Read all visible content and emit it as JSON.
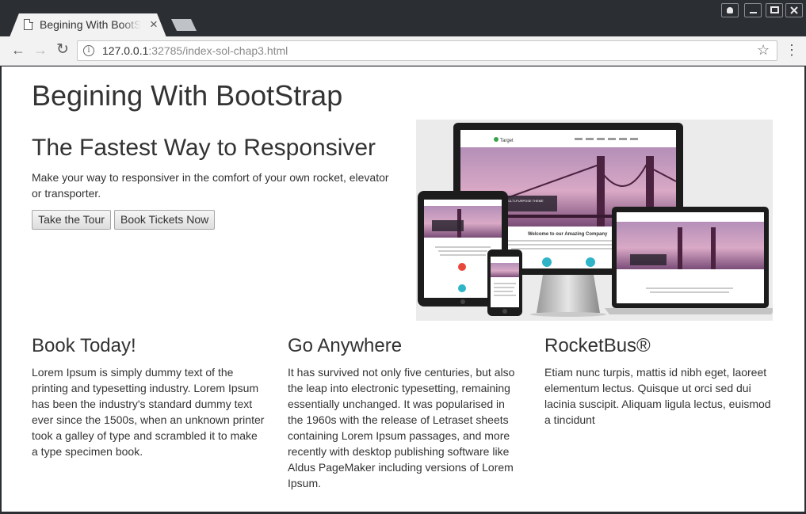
{
  "browser": {
    "tab_title": "Begining With BootStrap",
    "tab_close": "×",
    "url_host": "127.0.0.1",
    "url_rest": ":32785/index-sol-chap3.html"
  },
  "icons": {
    "back": "←",
    "forward": "→",
    "reload": "↻",
    "info": "i",
    "star": "☆",
    "menu": "⋮"
  },
  "page": {
    "heading": "Begining With BootStrap",
    "hero": {
      "title": "The Fastest Way to Responsiver",
      "text": "Make your way to responsiver in the comfort of your own rocket, elevator or transporter.",
      "buttons": [
        "Take the Tour",
        "Book Tickets Now"
      ]
    },
    "hero_image": {
      "logo": "Target",
      "banner": "MULTI-PURPOSE THEME",
      "welcome": "Welcome to our Amazing Company"
    },
    "columns": [
      {
        "title": "Book Today!",
        "text": "Lorem Ipsum is simply dummy text of the printing and typesetting industry. Lorem Ipsum has been the industry's standard dummy text ever since the 1500s, when an unknown printer took a galley of type and scrambled it to make a type specimen book."
      },
      {
        "title": "Go Anywhere",
        "text": "It has survived not only five centuries, but also the leap into electronic typesetting, remaining essentially unchanged. It was popularised in the 1960s with the release of Letraset sheets containing Lorem Ipsum passages, and more recently with desktop publishing software like Aldus PageMaker including versions of Lorem Ipsum."
      },
      {
        "title": "RocketBus®",
        "text": "Etiam nunc turpis, mattis id nibh eget, laoreet elementum lectus. Quisque ut orci sed dui lacinia suscipit. Aliquam ligula lectus, euismod a tincidunt"
      }
    ]
  }
}
